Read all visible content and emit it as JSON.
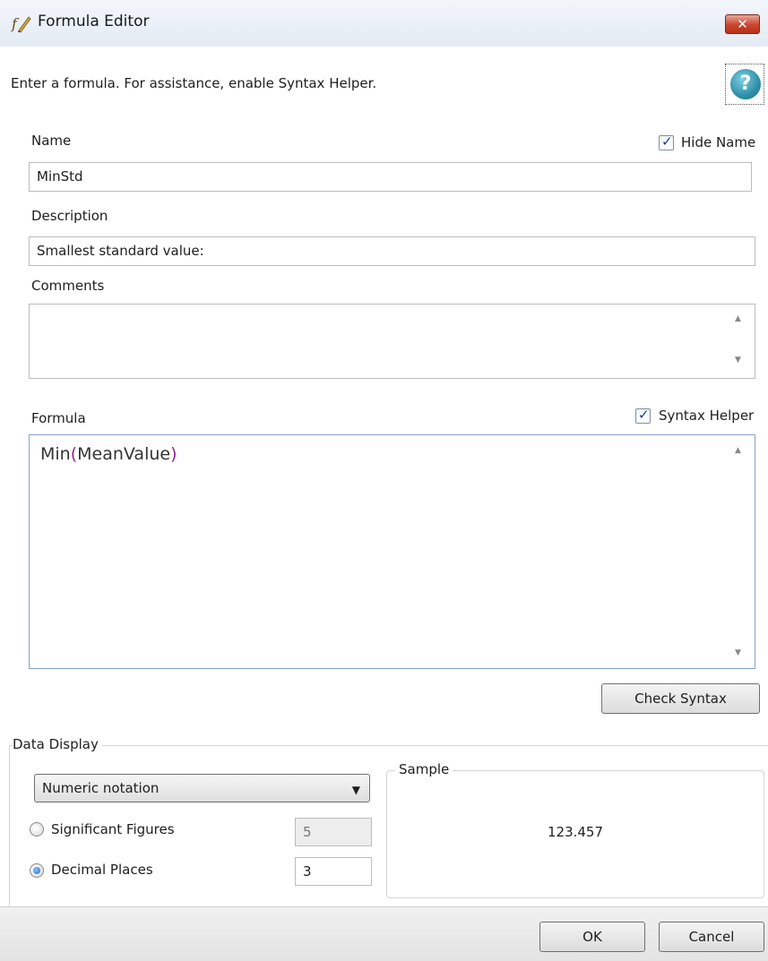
{
  "window": {
    "title": "Formula Editor",
    "close_glyph": "✕",
    "app_icon": "formula-fx-icon"
  },
  "instructions": "Enter a formula. For assistance, enable Syntax Helper.",
  "help": {
    "icon": "help-icon",
    "glyph": "?"
  },
  "name": {
    "label": "Name",
    "value": "MinStd",
    "hide_label": "Hide Name",
    "hide_checked": true
  },
  "description": {
    "label": "Description",
    "value": "Smallest standard value:"
  },
  "comments": {
    "label": "Comments",
    "value": ""
  },
  "formula": {
    "label": "Formula",
    "syntax_helper_label": "Syntax Helper",
    "syntax_helper_checked": true,
    "func": "Min",
    "open": "(",
    "arg": "MeanValue",
    "close": ")",
    "check_button": "Check Syntax"
  },
  "data_display": {
    "label": "Data Display",
    "notation": "Numeric notation",
    "sig_figs_label": "Significant Figures",
    "sig_figs_value": "5",
    "sig_figs_selected": false,
    "decimal_label": "Decimal Places",
    "decimal_value": "3",
    "decimal_selected": true,
    "sample_label": "Sample",
    "sample_value": "123.457"
  },
  "buttons": {
    "ok": "OK",
    "cancel": "Cancel"
  },
  "colors": {
    "paren_accent": "#8a2b8a",
    "close_red": "#c9452d",
    "help_teal": "#2f8fa8"
  }
}
